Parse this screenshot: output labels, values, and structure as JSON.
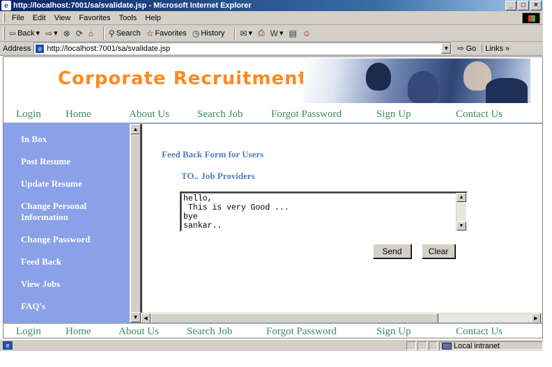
{
  "window": {
    "title": "http://localhost:7001/sa/svalidate.jsp - Microsoft Internet Explorer",
    "buttons": [
      "_",
      "□",
      "×"
    ]
  },
  "menubar": {
    "items": [
      "File",
      "Edit",
      "View",
      "Favorites",
      "Tools",
      "Help"
    ]
  },
  "toolbar": {
    "back": "Back",
    "search": "Search",
    "favorites": "Favorites",
    "history": "History"
  },
  "address": {
    "label": "Address",
    "url": "http://localhost:7001/sa/svalidate.jsp",
    "go": "Go",
    "links": "Links"
  },
  "banner": {
    "title": "Corporate Recruitment System"
  },
  "nav": {
    "items": [
      "Login",
      "Home",
      "About Us",
      "Search Job",
      "Forgot Password",
      "Sign Up",
      "Contact Us"
    ]
  },
  "sidebar": {
    "items": [
      "In Box",
      "Post Resume",
      "Update Resume",
      "Change Personal Information",
      "Change Password",
      "Feed Back",
      "View  Jobs",
      "FAQ's"
    ]
  },
  "form": {
    "title": "Feed Back Form  for Users",
    "to_label": "TO..  Job Providers",
    "message": "hello,\n This is very Good ...\nbye\nsankar..",
    "send_label": "Send",
    "clear_label": "Clear"
  },
  "status": {
    "zone": "Local intranet"
  },
  "colors": {
    "accent_orange": "#ff8a1c",
    "nav_green": "#3a8a62",
    "sidebar_blue": "#8aa0e8",
    "label_blue": "#4a7ec0"
  }
}
